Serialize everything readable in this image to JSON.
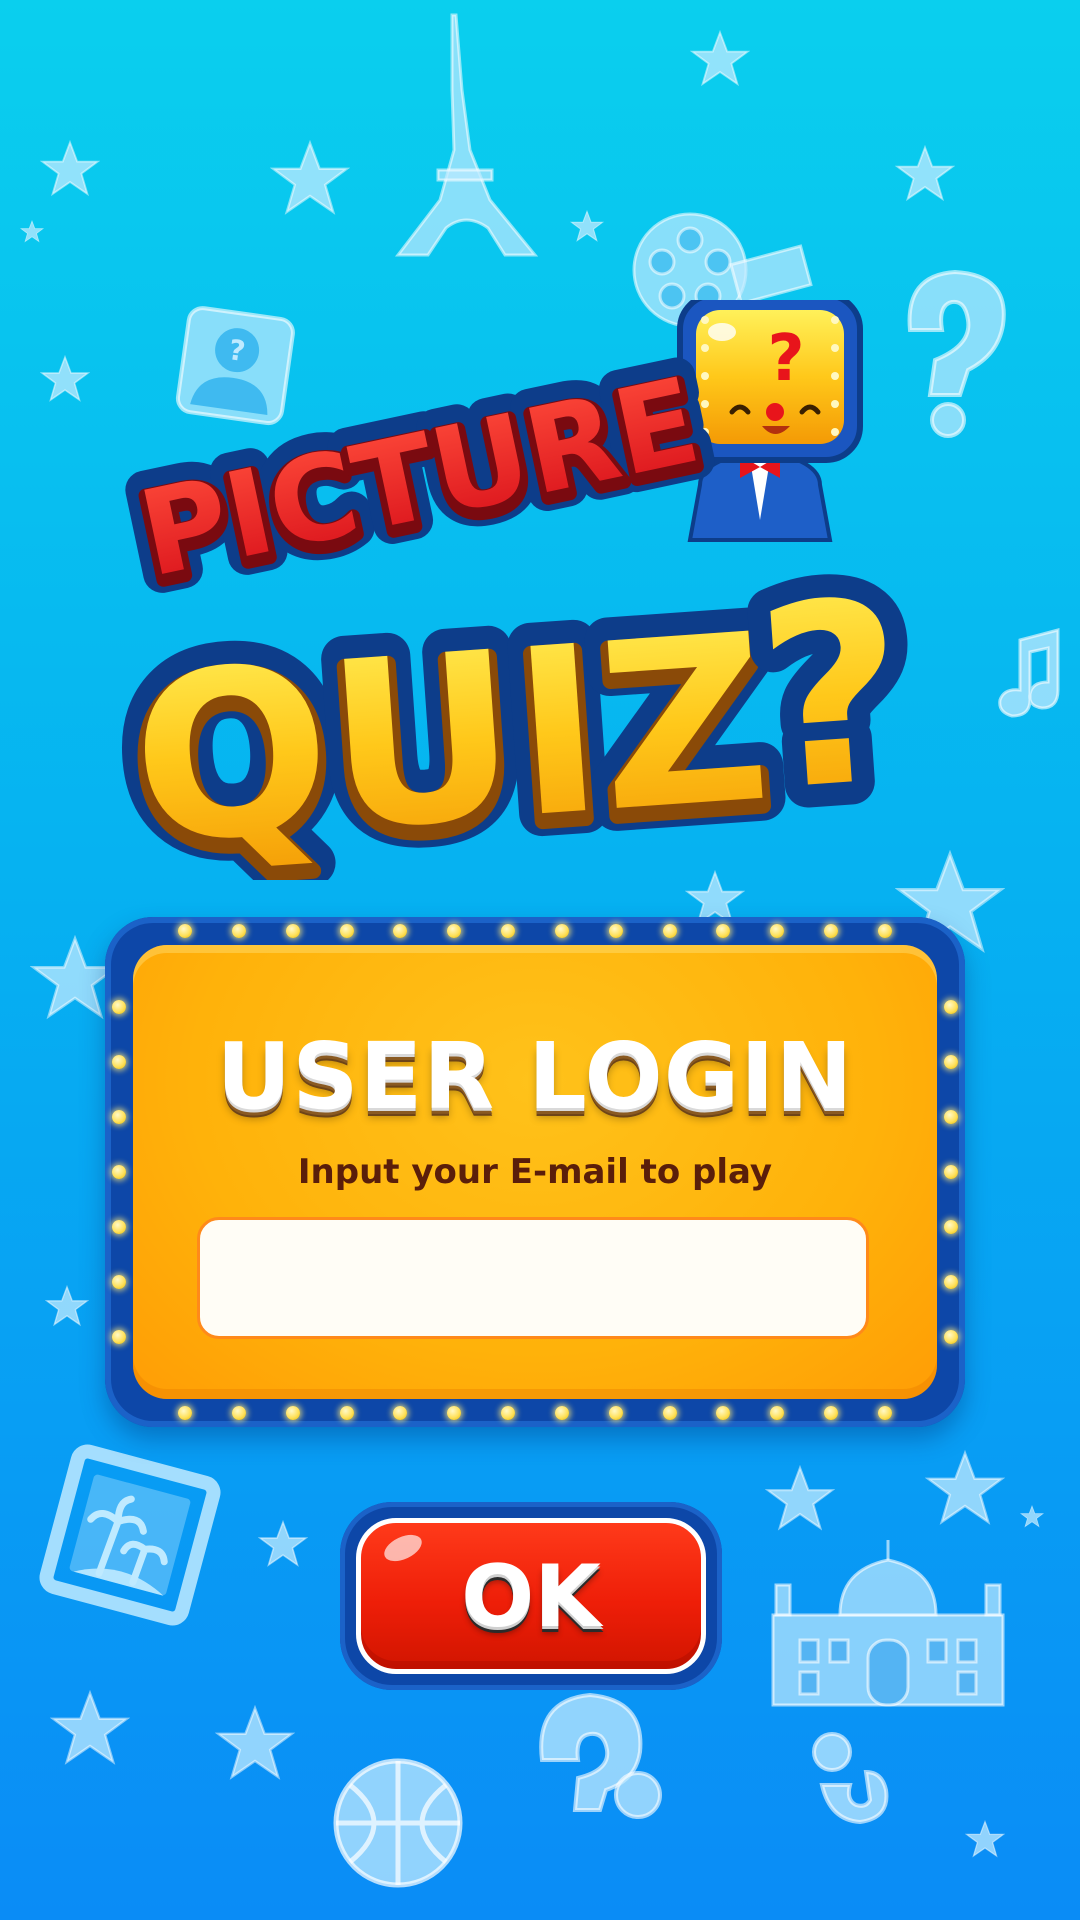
{
  "game": {
    "title_line1": "PICTURE",
    "title_line2": "QUIZ",
    "title_mark": "?"
  },
  "login": {
    "title": "USER LOGIN",
    "subtitle": "Input your E-mail to play",
    "email_value": "",
    "email_placeholder": ""
  },
  "actions": {
    "ok_label": "OK"
  },
  "colors": {
    "background_top": "#0acfee",
    "background_bottom": "#0a8cf6",
    "panel_border": "#0d47a8",
    "panel_fill": "#ffb20a",
    "title_red": "#e8141b",
    "title_yellow": "#ffc81a",
    "ok_red": "#ee1e08"
  },
  "icons": [
    "eiffel-tower-icon",
    "film-reel-icon",
    "question-mark-icon",
    "person-question-icon",
    "star-icon",
    "music-note-icon",
    "palm-tree-picture-icon",
    "taj-mahal-icon",
    "basketball-icon",
    "mascot-tv-head-icon"
  ]
}
